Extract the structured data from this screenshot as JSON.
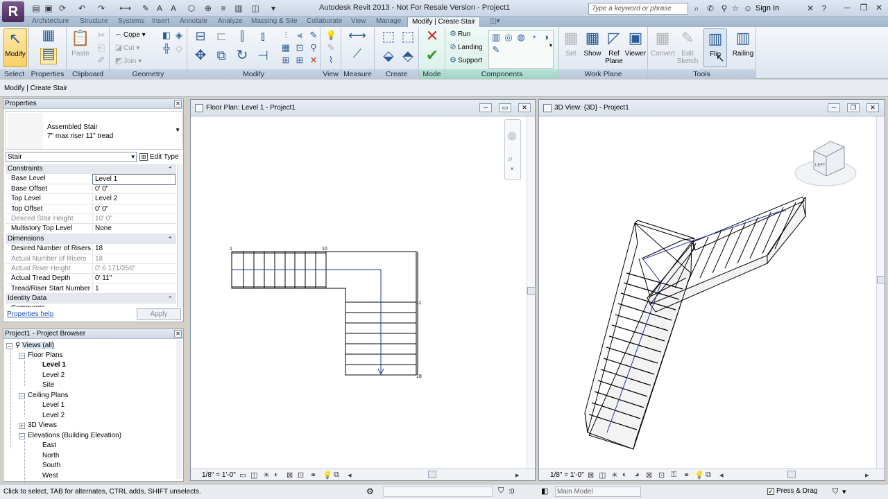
{
  "titlebar": {
    "app_logo": "R",
    "title": "Autodesk Revit 2013 -  Not For Resale Version -    Project1",
    "search_placeholder": "Type a keyword or phrase",
    "sign_in": "Sign In"
  },
  "tabs": [
    "Architecture",
    "Structure",
    "Systems",
    "Insert",
    "Annotate",
    "Analyze",
    "Massing & Site",
    "Collaborate",
    "View",
    "Manage",
    "Modify | Create Stair"
  ],
  "ribbon": {
    "select": {
      "button": "Modify",
      "label": "Select"
    },
    "properties": {
      "label": "Properties"
    },
    "clipboard": {
      "paste": "Paste",
      "label": "Clipboard"
    },
    "geometry": {
      "cope": "Cope",
      "cut": "Cut",
      "join": "Join",
      "label": "Geometry"
    },
    "modify": {
      "label": "Modify"
    },
    "view": {
      "label": "View"
    },
    "measure": {
      "label": "Measure"
    },
    "create": {
      "label": "Create"
    },
    "mode": {
      "label": "Mode"
    },
    "components": {
      "run": "Run",
      "landing": "Landing",
      "support": "Support",
      "label": "Components"
    },
    "workplane": {
      "set": "Set",
      "show": "Show",
      "ref_plane_1": "Ref",
      "ref_plane_2": "Plane",
      "viewer": "Viewer",
      "label": "Work Plane"
    },
    "tools": {
      "convert": "Convert",
      "edit_sketch_1": "Edit",
      "edit_sketch_2": "Sketch",
      "flip": "Flip",
      "railing": "Railing",
      "label": "Tools"
    }
  },
  "options_bar": {
    "context": "Modify | Create Stair"
  },
  "properties": {
    "title": "Properties",
    "type_line1": "Assembled Stair",
    "type_line2": "7\" max riser 11\" tread",
    "instance": "Stair",
    "edit_type": "Edit Type",
    "rows": [
      {
        "kind": "group",
        "name": "Constraints"
      },
      {
        "kind": "edit",
        "name": "Base Level",
        "value": "Level 1"
      },
      {
        "kind": "normal",
        "name": "Base Offset",
        "value": "0'  0\""
      },
      {
        "kind": "normal",
        "name": "Top Level",
        "value": "Level 2"
      },
      {
        "kind": "normal",
        "name": "Top Offset",
        "value": "0'  0\""
      },
      {
        "kind": "ro",
        "name": "Desired Stair Height",
        "value": "10'  0\""
      },
      {
        "kind": "normal",
        "name": "Multistory Top Level",
        "value": "None"
      },
      {
        "kind": "group",
        "name": "Dimensions"
      },
      {
        "kind": "normal",
        "name": "Desired Number of Risers",
        "value": "18"
      },
      {
        "kind": "ro",
        "name": "Actual Number of Risers",
        "value": "18"
      },
      {
        "kind": "ro",
        "name": "Actual Riser Height",
        "value": "0'  6 171/256\""
      },
      {
        "kind": "normal",
        "name": "Actual Tread Depth",
        "value": "0'  11\""
      },
      {
        "kind": "normal",
        "name": "Tread/Riser Start Number",
        "value": "1"
      },
      {
        "kind": "group",
        "name": "Identity Data"
      },
      {
        "kind": "normal",
        "name": "Comments",
        "value": ""
      }
    ],
    "help": "Properties help",
    "apply": "Apply"
  },
  "browser": {
    "title": "Project1 - Project Browser",
    "views_all": "Views (all)",
    "floor_plans": "Floor Plans",
    "fp_level1": "Level 1",
    "fp_level2": "Level 2",
    "fp_site": "Site",
    "ceiling_plans": "Ceiling Plans",
    "cp_level1": "Level 1",
    "cp_level2": "Level 2",
    "views_3d": "3D Views",
    "elevations": "Elevations (Building Elevation)",
    "east": "East",
    "north": "North",
    "south": "South",
    "west": "West"
  },
  "floorplan": {
    "title": "Floor Plan: Level 1 - Project1",
    "scale": "1/8\" = 1'-0\"",
    "riser_1": "1",
    "riser_10": "10",
    "riser_11": "11",
    "riser_18": "18"
  },
  "view3d": {
    "title": "3D View: {3D} - Project1",
    "scale": "1/8\" = 1'-0\"",
    "viewcube_face": "LEFT"
  },
  "statusbar": {
    "hint": "Click to select, TAB for alternates, CTRL adds, SHIFT unselects.",
    "count": ":0",
    "model": "Main Model",
    "press_drag": "Press & Drag"
  },
  "colors": {
    "context_tab": "#9fd3c6",
    "selection": "#f7d069",
    "accent": "#2b5c9a"
  }
}
